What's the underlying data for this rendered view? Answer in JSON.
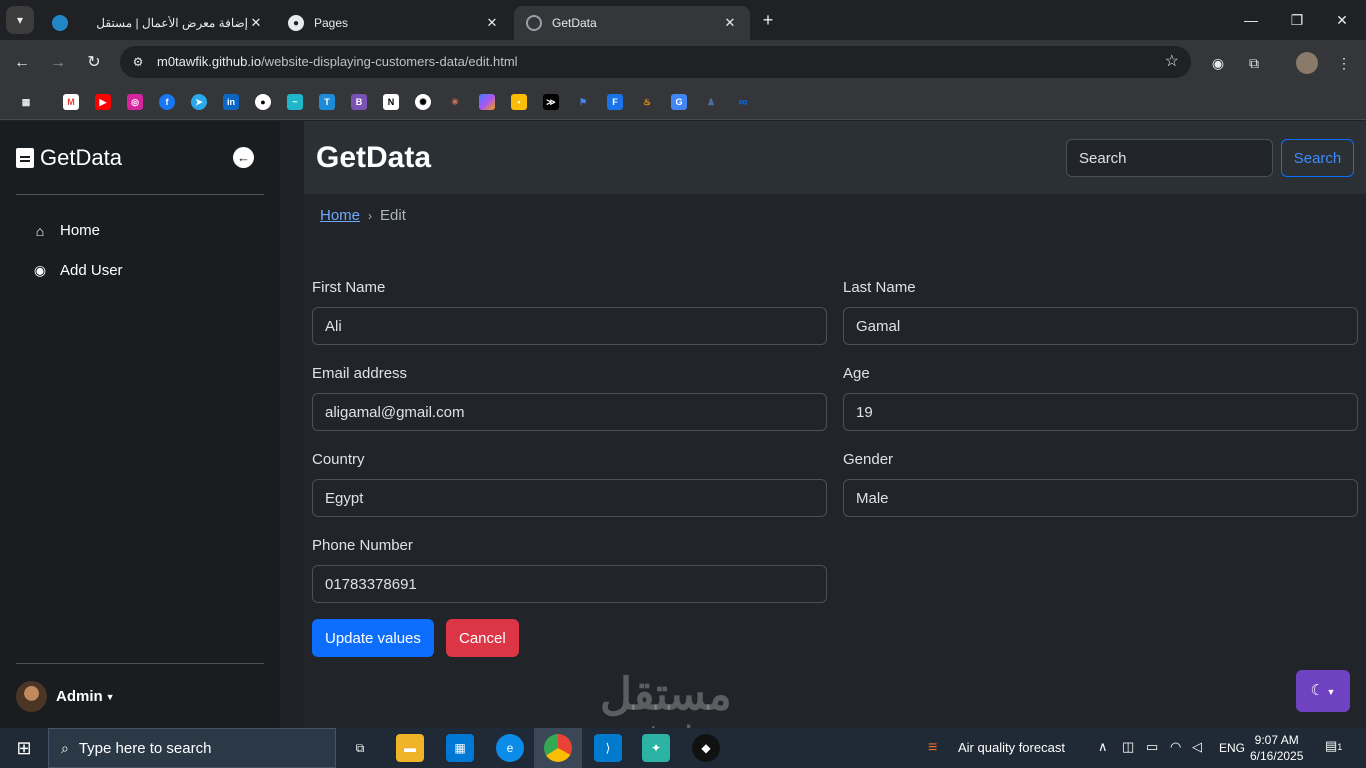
{
  "browser": {
    "tabs": [
      {
        "title": "إضافة معرض الأعمال | مستقل",
        "active": false
      },
      {
        "title": "Pages",
        "active": false
      },
      {
        "title": "GetData",
        "active": true
      }
    ],
    "url_host": "m0tawfik.github.io",
    "url_path": "/website-displaying-customers-data/edit.html",
    "icons": {
      "back": "arrow-left-icon",
      "forward": "arrow-right-icon",
      "reload": "reload-icon",
      "star": "star-icon"
    },
    "bookmarks": [
      "apps-icon",
      "gmail-icon",
      "youtube-icon",
      "instagram-icon",
      "facebook-icon",
      "telegram-icon",
      "linkedin-icon",
      "github-icon",
      "bookmark-icon",
      "bookmark-icon",
      "bootstrap-icon",
      "notion-icon",
      "chatgpt-icon",
      "claude-icon",
      "copilot-icon",
      "bookmark-icon",
      "terminal-icon",
      "flag-icon",
      "bookmark-icon",
      "bookmark-icon",
      "translate-icon",
      "bookmark-icon",
      "meta-icon"
    ]
  },
  "sidebar": {
    "brand": "GetData",
    "items": [
      {
        "label": "Home",
        "icon": "home-icon"
      },
      {
        "label": "Add User",
        "icon": "user-circle-icon"
      }
    ],
    "user": "Admin"
  },
  "header": {
    "title": "GetData",
    "search_placeholder": "Search",
    "search_button": "Search"
  },
  "breadcrumb": {
    "home": "Home",
    "current": "Edit"
  },
  "form": {
    "first_name": {
      "label": "First Name",
      "value": "Ali"
    },
    "last_name": {
      "label": "Last Name",
      "value": "Gamal"
    },
    "email": {
      "label": "Email address",
      "value": "aligamal@gmail.com"
    },
    "age": {
      "label": "Age",
      "value": "19"
    },
    "country": {
      "label": "Country",
      "value": "Egypt"
    },
    "gender": {
      "label": "Gender",
      "value": "Male"
    },
    "phone": {
      "label": "Phone Number",
      "value": "01783378691"
    },
    "update_button": "Update values",
    "cancel_button": "Cancel"
  },
  "watermark": {
    "line1": "مستقل",
    "line2": "mostaql.com"
  },
  "taskbar": {
    "search_placeholder": "Type here to search",
    "weather": "Air quality forecast",
    "language": "ENG",
    "time": "9:07 AM",
    "date": "6/16/2025",
    "notifications": "1"
  }
}
